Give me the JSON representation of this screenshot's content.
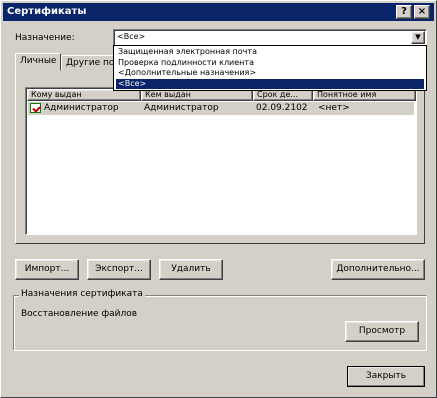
{
  "window": {
    "title": "Сертификаты",
    "help_button": "?",
    "close_button": "×"
  },
  "purpose": {
    "label": "Назначение:",
    "selected": "<Все>",
    "options": [
      "Защищенная электронная почта",
      "Проверка подлинности клиента",
      "<Дополнительные назначения>",
      "<Все>"
    ]
  },
  "tabs": [
    {
      "label": "Личные"
    },
    {
      "label": "Другие по"
    }
  ],
  "table": {
    "columns": [
      "Кому выдан",
      "Кем выдан",
      "Срок де...",
      "Понятное имя"
    ],
    "rows": [
      {
        "issued_to": "Администратор",
        "issued_by": "Администратор",
        "expires": "02.09.2102",
        "friendly_name": "<нет>"
      }
    ]
  },
  "buttons": {
    "import": "Импорт...",
    "export": "Экспорт...",
    "remove": "Удалить",
    "advanced": "Дополнительно...",
    "view": "Просмотр",
    "close": "Закрыть"
  },
  "cert_purposes": {
    "title": "Назначения сертификата",
    "value": "Восстановление файлов"
  }
}
